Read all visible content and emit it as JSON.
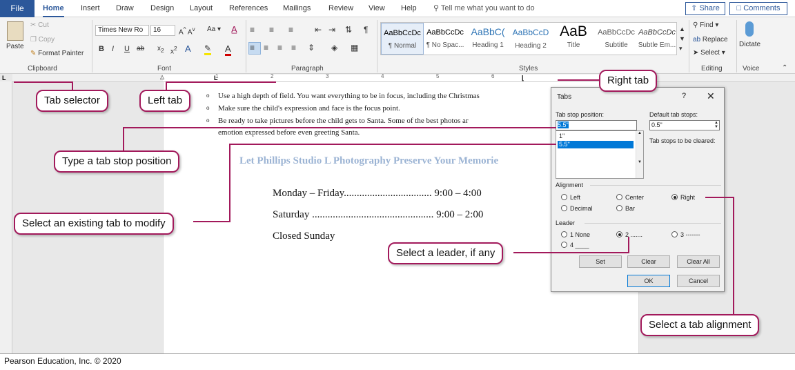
{
  "ribbon_tabs": [
    "File",
    "Home",
    "Insert",
    "Draw",
    "Design",
    "Layout",
    "References",
    "Mailings",
    "Review",
    "View",
    "Help"
  ],
  "tell_me": "Tell me what you want to do",
  "share": "Share",
  "comments": "Comments",
  "clipboard": {
    "paste": "Paste",
    "cut": "Cut",
    "copy": "Copy",
    "format_painter": "Format Painter",
    "label": "Clipboard"
  },
  "font": {
    "name": "Times New Ro",
    "size": "16",
    "label": "Font"
  },
  "paragraph": {
    "label": "Paragraph"
  },
  "styles": {
    "label": "Styles",
    "items": [
      {
        "preview": "AaBbCcDc",
        "name": "¶ Normal"
      },
      {
        "preview": "AaBbCcDc",
        "name": "¶ No Spac..."
      },
      {
        "preview": "AaBbC(",
        "name": "Heading 1"
      },
      {
        "preview": "AaBbCcD",
        "name": "Heading 2"
      },
      {
        "preview": "AaB",
        "name": "Title"
      },
      {
        "preview": "AaBbCcDc",
        "name": "Subtitle"
      },
      {
        "preview": "AaBbCcDc",
        "name": "Subtle Em..."
      }
    ]
  },
  "editing": {
    "find": "Find",
    "replace": "Replace",
    "select": "Select",
    "label": "Editing"
  },
  "voice": {
    "dictate": "Dictate",
    "label": "Voice"
  },
  "ruler_numbers": [
    "1",
    "2",
    "3",
    "4",
    "5",
    "6"
  ],
  "doc": {
    "bullets": [
      "Use a high depth of field. You want everything to be in focus, including the Christmas",
      "Make sure the child's expression and face is the focus point.",
      "Be ready to take pictures before the child gets to Santa. Some of the best photos ar",
      "emotion expressed before even greeting Santa."
    ],
    "title": "Let Phillips Studio L Photography Preserve Your Memorie",
    "lines": [
      "Monday – Friday.................................. 9:00 – 4:00",
      "Saturday ............................................... 9:00 – 2:00",
      "Closed Sunday"
    ]
  },
  "dialog": {
    "title": "Tabs",
    "help": "?",
    "close": "✕",
    "tab_stop_label": "Tab stop position:",
    "tab_stop_value": "5.5\"",
    "default_label": "Default tab stops:",
    "default_value": "0.5\"",
    "cleared_label": "Tab stops to be cleared:",
    "list": [
      "1\"",
      "5.5\""
    ],
    "alignment_label": "Alignment",
    "alignment": [
      "Left",
      "Center",
      "Right",
      "Decimal",
      "Bar"
    ],
    "leader_label": "Leader",
    "leaders": [
      "1 None",
      "2 .......",
      "3 -------",
      "4 ____"
    ],
    "buttons": {
      "set": "Set",
      "clear": "Clear",
      "clear_all": "Clear All",
      "ok": "OK",
      "cancel": "Cancel"
    }
  },
  "callouts": {
    "tab_selector": "Tab selector",
    "left_tab": "Left tab",
    "right_tab": "Right tab",
    "type_pos": "Type a tab stop position",
    "select_existing": "Select an existing tab to modify",
    "select_leader": "Select a leader, if any",
    "select_align": "Select a tab alignment"
  },
  "footer": "Pearson Education, Inc. © 2020",
  "colors": {
    "accent": "#2b579a",
    "callout_border": "#a2195b",
    "title_blue": "#9cb4d4"
  }
}
